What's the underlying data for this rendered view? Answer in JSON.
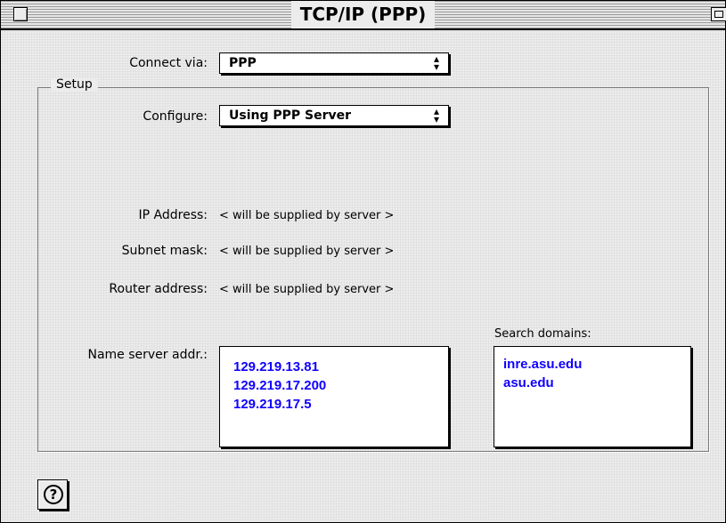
{
  "window": {
    "title": "TCP/IP (PPP)"
  },
  "connect_via": {
    "label": "Connect via:",
    "value": "PPP"
  },
  "setup": {
    "legend": "Setup",
    "configure": {
      "label": "Configure:",
      "value": "Using PPP Server"
    },
    "ip_address": {
      "label": "IP Address:",
      "value": "< will be supplied by server >"
    },
    "subnet_mask": {
      "label": "Subnet mask:",
      "value": "< will be supplied by server >"
    },
    "router_address": {
      "label": "Router address:",
      "value": "< will be supplied by server >"
    },
    "name_server": {
      "label": "Name server addr.:",
      "entries": [
        "129.219.13.81",
        "129.219.17.200",
        "129.219.17.5"
      ]
    },
    "search_domains": {
      "label": "Search domains:",
      "entries": [
        "inre.asu.edu",
        "asu.edu"
      ]
    }
  },
  "icons": {
    "close": "close-box-icon",
    "zoom": "zoom-box-icon",
    "popup_arrows": "up-down-arrows-icon",
    "help": "question-mark-icon"
  },
  "colors": {
    "list_text": "#0f00ff"
  }
}
